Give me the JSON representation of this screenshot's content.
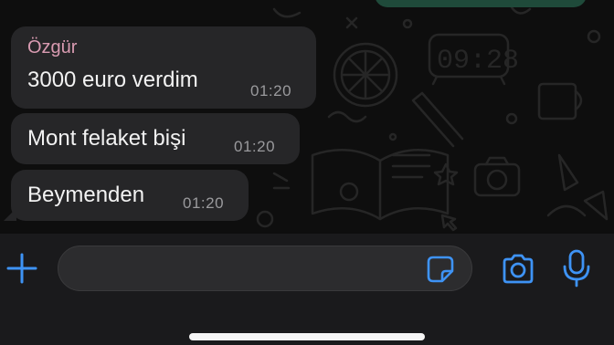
{
  "colors": {
    "chat_background": "#0e0e0e",
    "incoming_bubble": "#262628",
    "sender_name": "#d99bb1",
    "accent_blue": "#3e93f5",
    "bottom_bar": "#1a1a1c",
    "outgoing_bubble": "#1f4a3a"
  },
  "messages": [
    {
      "sender": "Özgür",
      "text": "3000 euro verdim",
      "time": "01:20"
    },
    {
      "text": "Mont felaket bişi",
      "time": "01:20"
    },
    {
      "text": "Beymenden",
      "time": "01:20"
    }
  ],
  "composer": {
    "value": "",
    "placeholder": "",
    "icons": {
      "attach": "plus-icon",
      "sticker": "sticker-icon",
      "camera": "camera-icon",
      "voice": "microphone-icon"
    }
  }
}
